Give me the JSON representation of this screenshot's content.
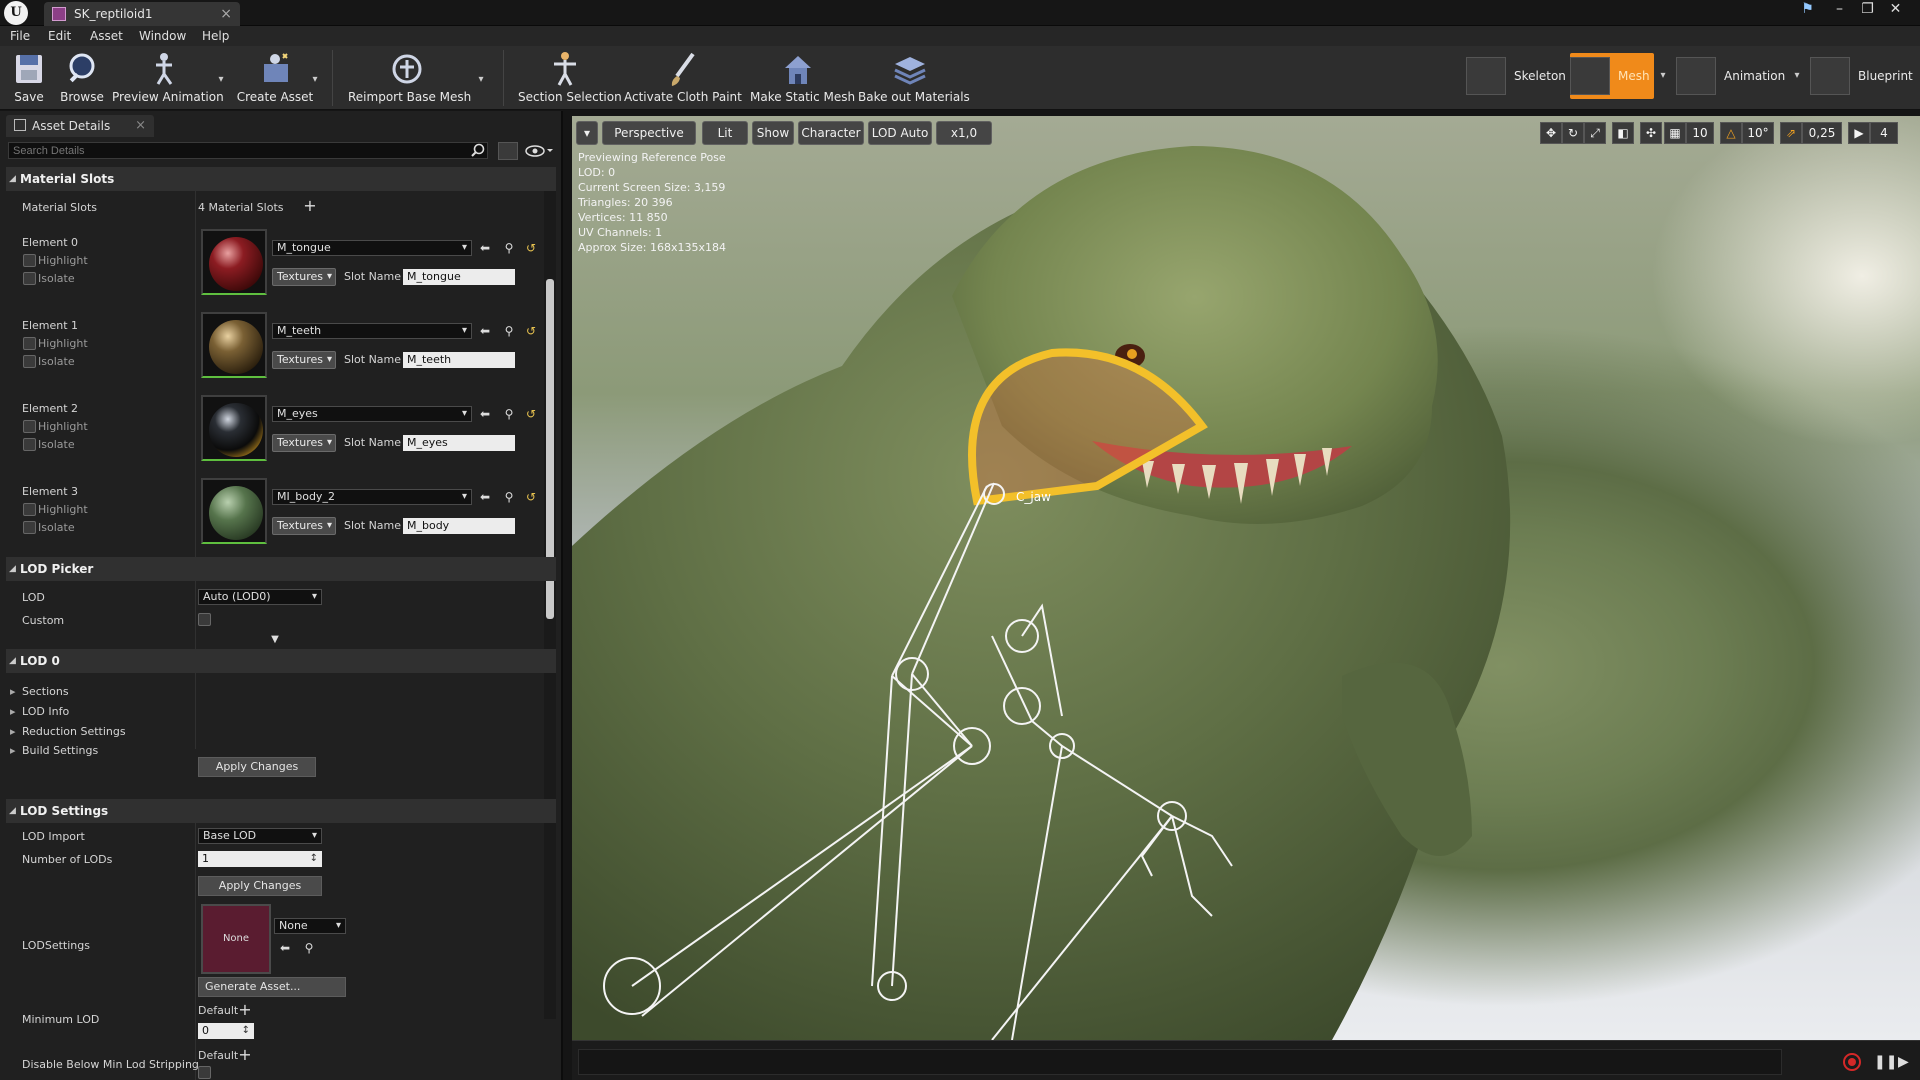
{
  "window": {
    "tab_title": "SK_reptiloid1",
    "logo": "U"
  },
  "menu": [
    "File",
    "Edit",
    "Asset",
    "Window",
    "Help"
  ],
  "toolbar": {
    "save": "Save",
    "browse": "Browse",
    "preview_animation": "Preview Animation",
    "create_asset": "Create Asset",
    "reimport": "Reimport Base Mesh",
    "section_selection": "Section Selection",
    "activate_cloth": "Activate Cloth Paint",
    "make_static": "Make Static Mesh",
    "bake_materials": "Bake out Materials"
  },
  "modes": {
    "skeleton": "Skeleton",
    "mesh": "Mesh",
    "animation": "Animation",
    "blueprint": "Blueprint",
    "active": "Mesh"
  },
  "details": {
    "tab": "Asset Details",
    "search_placeholder": "Search Details",
    "material_slots": {
      "header": "Material Slots",
      "label": "Material Slots",
      "count": "4 Material Slots",
      "highlight": "Highlight",
      "isolate": "Isolate",
      "textures": "Textures",
      "slot_name_label": "Slot Name",
      "elements": [
        {
          "label": "Element 0",
          "material": "M_tongue",
          "slot": "M_tongue",
          "color": "#6e1518"
        },
        {
          "label": "Element 1",
          "material": "M_teeth",
          "slot": "M_teeth",
          "color": "#5a4528"
        },
        {
          "label": "Element 2",
          "material": "M_eyes",
          "slot": "M_eyes",
          "color": "#1b1b1b"
        },
        {
          "label": "Element 3",
          "material": "MI_body_2",
          "slot": "M_body",
          "color": "#4d6a48"
        }
      ]
    },
    "lod_picker": {
      "header": "LOD Picker",
      "lod_label": "LOD",
      "lod_value": "Auto (LOD0)",
      "custom_label": "Custom"
    },
    "lod0": {
      "header": "LOD 0",
      "items": [
        "Sections",
        "LOD Info",
        "Reduction Settings",
        "Build Settings"
      ],
      "apply": "Apply Changes"
    },
    "lod_settings": {
      "header": "LOD Settings",
      "lod_import_label": "LOD Import",
      "lod_import_value": "Base LOD",
      "num_lods_label": "Number of LODs",
      "num_lods_value": "1",
      "apply": "Apply Changes",
      "lodsettings_label": "LODSettings",
      "asset_thumb": "None",
      "asset_value": "None",
      "generate": "Generate Asset...",
      "min_lod_label": "Minimum LOD",
      "min_lod_default": "Default",
      "min_lod_value": "0",
      "disable_label": "Disable Below Min Lod Stripping",
      "disable_default": "Default"
    }
  },
  "viewport": {
    "perspective": "Perspective",
    "lit": "Lit",
    "show": "Show",
    "character": "Character",
    "lod": "LOD Auto",
    "speed": "x1,0",
    "info": [
      "Previewing Reference Pose",
      "LOD: 0",
      "Current Screen Size: 3,159",
      "Triangles: 20 396",
      "Vertices: 11 850",
      "UV Channels: 1",
      "Approx Size: 168x135x184"
    ],
    "grid_snap": "10",
    "rot_snap": "10°",
    "scale_snap": "0,25",
    "cam_speed": "4",
    "bone_label": "C_jaw"
  }
}
